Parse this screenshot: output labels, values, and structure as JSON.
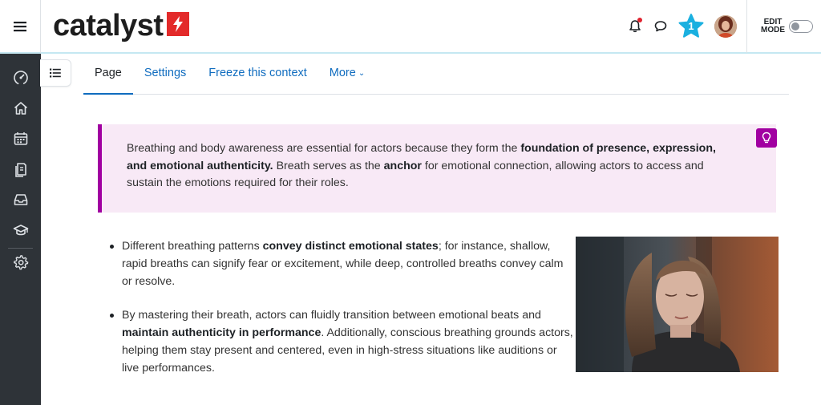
{
  "navbar": {
    "logo_text": "catalyst",
    "notification_count": "1",
    "edit_mode_label_line1": "EDIT",
    "edit_mode_label_line2": "MODE",
    "edit_mode_on": false
  },
  "sidebar": {
    "items": [
      {
        "icon": "dashboard-icon"
      },
      {
        "icon": "home-icon"
      },
      {
        "icon": "calendar-icon"
      },
      {
        "icon": "files-icon"
      },
      {
        "icon": "inbox-icon"
      },
      {
        "icon": "graduation-cap-icon"
      },
      {
        "icon": "gear-icon"
      }
    ]
  },
  "tabs": [
    {
      "label": "Page",
      "active": true
    },
    {
      "label": "Settings",
      "active": false
    },
    {
      "label": "Freeze this context",
      "active": false
    },
    {
      "label": "More",
      "active": false
    }
  ],
  "callout": {
    "part1": "Breathing and body awareness are essential for actors because they form the ",
    "bold1": "foundation of presence, expression, and emotional authenticity.",
    "part2": " Breath serves as the ",
    "bold2": "anchor",
    "part3": " for emotional connection, allowing actors to access and sustain the emotions required for their roles."
  },
  "bullets": [
    {
      "before": "Different breathing patterns ",
      "bold": "convey distinct emotional states",
      "after": "; for instance, shallow, rapid breaths can signify fear or excitement, while deep, controlled breaths convey calm or resolve."
    },
    {
      "before": "By mastering their breath, actors can fluidly transition between emotional beats and ",
      "bold": "maintain authenticity in performance",
      "after": ". Additionally, conscious breathing grounds actors, helping them stay present and centered, even in high-stress situations like auditions or live performances."
    }
  ],
  "colors": {
    "accent": "#0f6cbf",
    "callout_border": "#a100a1",
    "callout_bg": "#f8e9f6",
    "sidebar_bg": "#2e3338",
    "logo_red": "#e32a2a",
    "star": "#1ab0e0"
  }
}
